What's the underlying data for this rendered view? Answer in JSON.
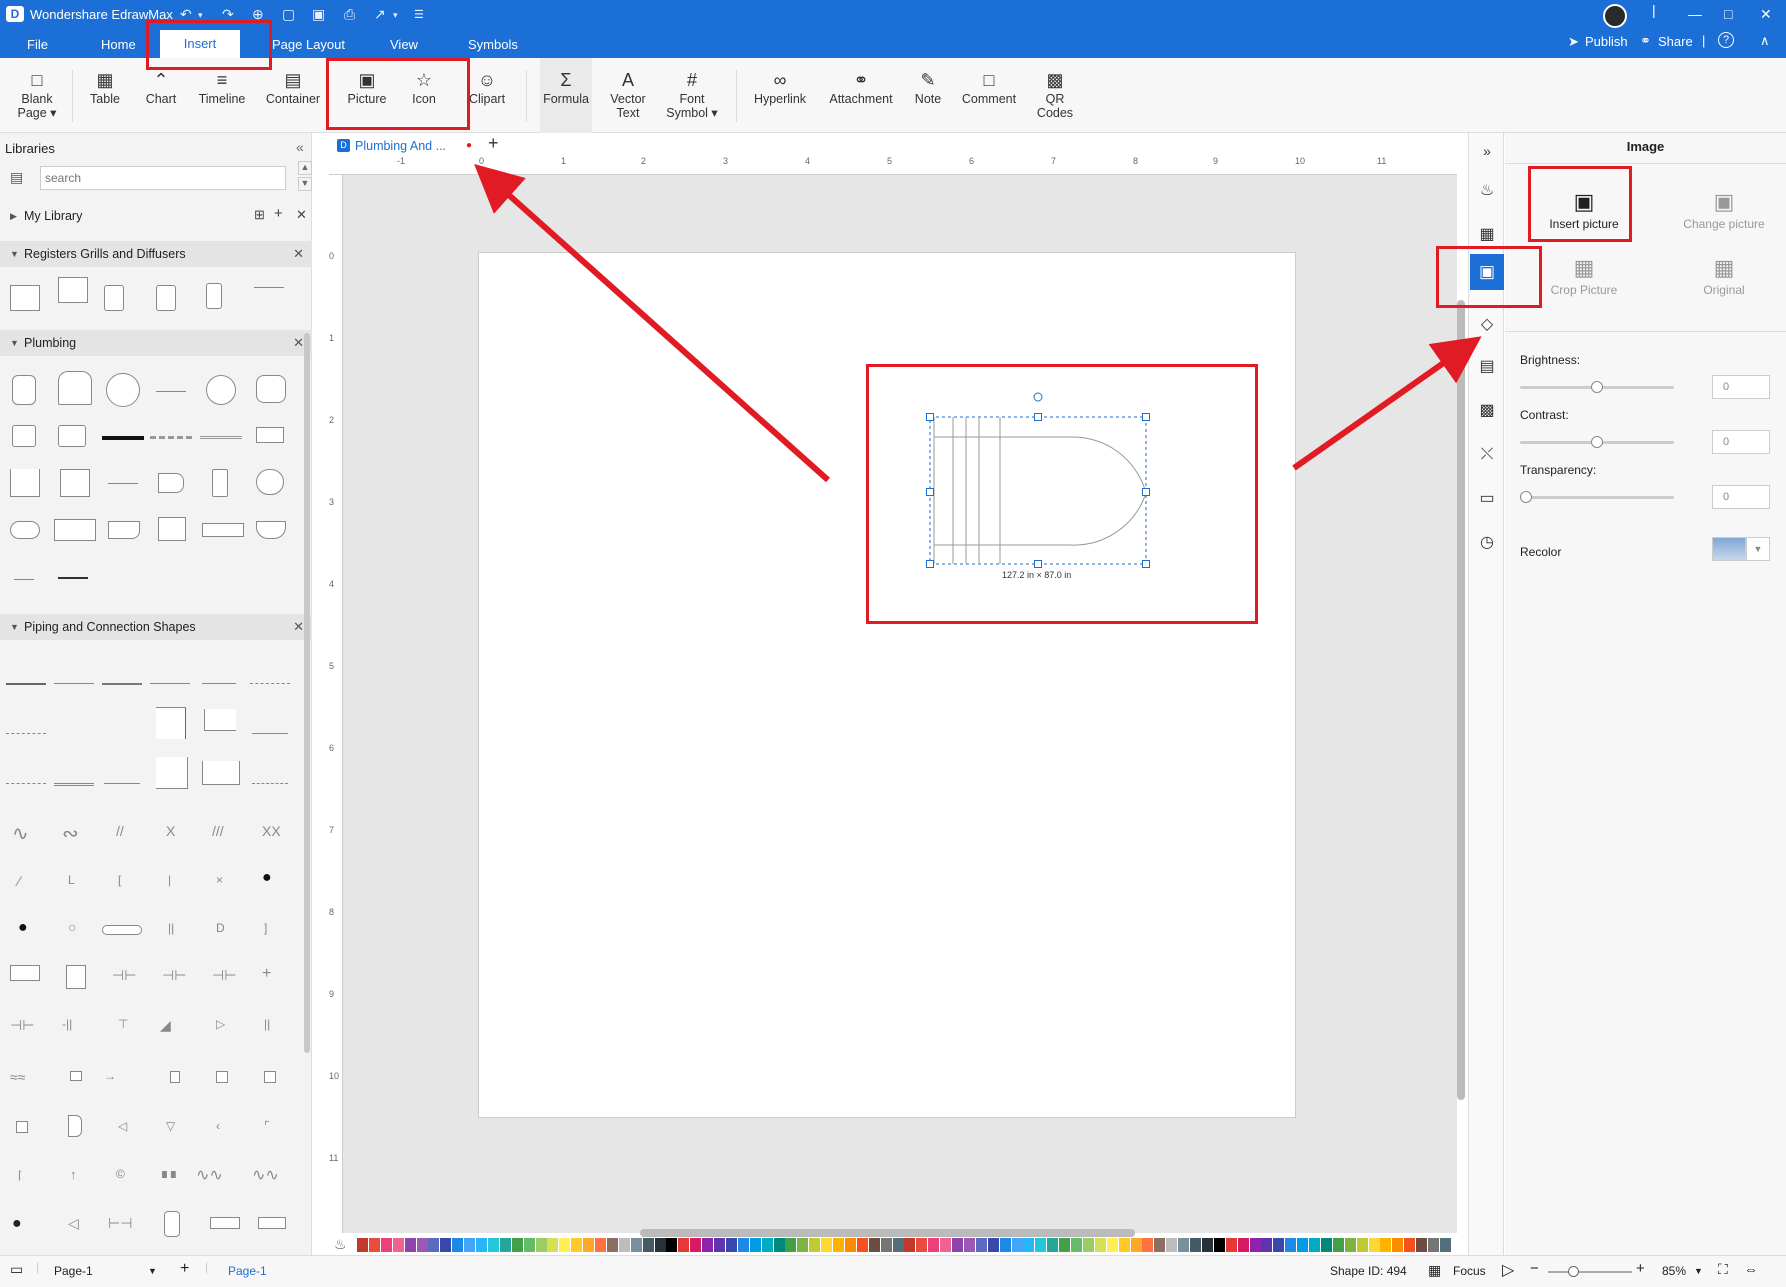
{
  "app": {
    "title": "Wondershare EdrawMax",
    "logo_letter": "D"
  },
  "quick_access": [
    "↶",
    "▾",
    "↷",
    "⊕",
    "▢",
    "▣",
    "⎙",
    "↗",
    "▾",
    "☰"
  ],
  "menu": {
    "file": "File",
    "home": "Home",
    "insert": "Insert",
    "page_layout": "Page Layout",
    "view": "View",
    "symbols": "Symbols"
  },
  "topright": {
    "publish": "Publish",
    "share": "Share",
    "help": "?"
  },
  "window_controls": {
    "minimize": "—",
    "maximize": "□",
    "close": "✕",
    "collapse": "∧"
  },
  "ribbon": {
    "blank_page": "Blank Page ▾",
    "table": "Table",
    "chart": "Chart",
    "timeline": "Timeline",
    "container": "Container",
    "picture": "Picture",
    "icon": "Icon",
    "clipart": "Clipart",
    "formula": "Formula",
    "vector_text": "Vector Text",
    "font_symbol": "Font Symbol ▾",
    "hyperlink": "Hyperlink",
    "attachment": "Attachment",
    "note": "Note",
    "comment": "Comment",
    "qr_codes": "QR Codes"
  },
  "left_panel": {
    "title": "Libraries",
    "search_placeholder": "search",
    "my_library": "My Library",
    "sections": {
      "registers": "Registers Grills and Diffusers",
      "plumbing": "Plumbing",
      "piping": "Piping and Connection Shapes"
    }
  },
  "document": {
    "tab_label": "Plumbing And ...",
    "add_tab": "+"
  },
  "ruler": {
    "h_ticks": [
      "-1",
      "0",
      "1",
      "2",
      "3",
      "4",
      "5",
      "6",
      "7",
      "8",
      "9",
      "10",
      "11"
    ],
    "v_ticks": [
      "0",
      "1",
      "2",
      "3",
      "4",
      "5",
      "6",
      "7",
      "8",
      "9",
      "10",
      "11"
    ]
  },
  "selection": {
    "dimensions": "127.2 in × 87.0 in"
  },
  "right_panel": {
    "title": "Image",
    "insert_picture": "Insert picture",
    "change_picture": "Change picture",
    "crop_picture": "Crop Picture",
    "original": "Original",
    "brightness_label": "Brightness:",
    "brightness_value": "0",
    "brightness_level": 0.5,
    "contrast_label": "Contrast:",
    "contrast_value": "0",
    "contrast_level": 0.5,
    "transparency_label": "Transparency:",
    "transparency_value": "0",
    "transparency_level": 0.0,
    "recolor_label": "Recolor"
  },
  "status": {
    "page_select": "Page-1",
    "page_tab": "Page-1",
    "add_page": "+",
    "shape_id": "Shape ID: 494",
    "focus": "Focus",
    "zoom": "85%"
  },
  "colors": {
    "accent": "#1b6fd6",
    "annotation": "#e01b24"
  }
}
